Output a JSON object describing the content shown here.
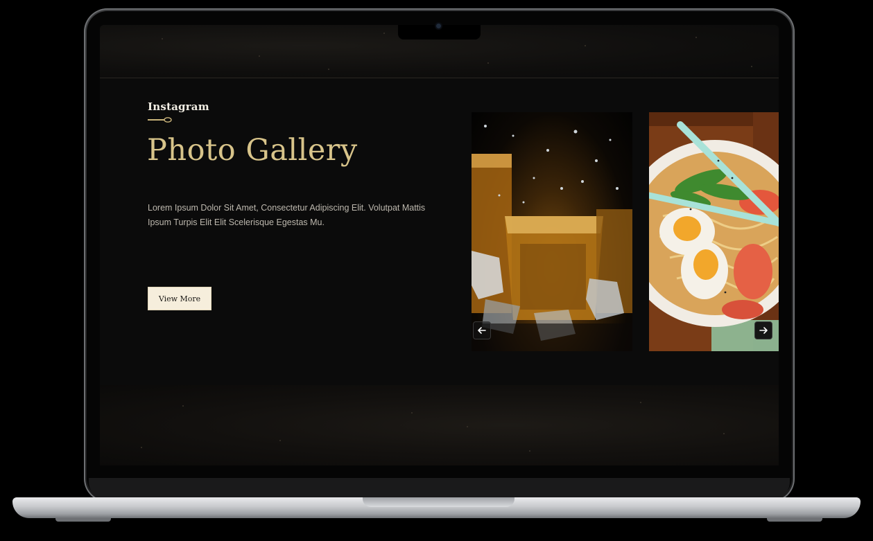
{
  "section": {
    "eyebrow": "Instagram",
    "heading": "Photo Gallery",
    "description": "Lorem Ipsum Dolor Sit Amet, Consectetur Adipiscing Elit. Volutpat Mattis Ipsum Turpis Elit Elit Scelerisque Egestas Mu.",
    "button_label": "View More"
  },
  "gallery": {
    "photos": [
      {
        "icon": "whisky-glasses-photo"
      },
      {
        "icon": "ramen-bowl-photo"
      }
    ],
    "prev_icon": "arrow-left-icon",
    "next_icon": "arrow-right-icon"
  },
  "colors": {
    "accent_gold": "#d8c48a",
    "background": "#0b0b0b",
    "button_bg": "#f6eedc"
  }
}
